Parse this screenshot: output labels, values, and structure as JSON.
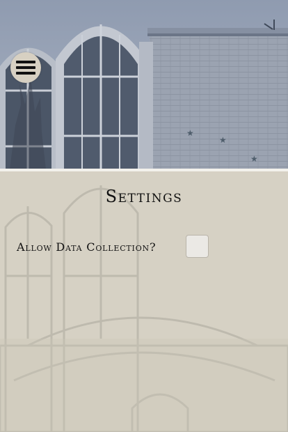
{
  "menu": {
    "icon": "hamburger-menu-icon"
  },
  "settings": {
    "title": "Settings",
    "options": [
      {
        "label": "Allow Data Collection?",
        "checked": false
      }
    ]
  },
  "colors": {
    "panel_background": "#d6d1c4",
    "text": "#111111",
    "checkbox_fill": "#ebe9e5",
    "menu_button_fill": "#d7d0c2",
    "divider": "#f3f1ec"
  }
}
